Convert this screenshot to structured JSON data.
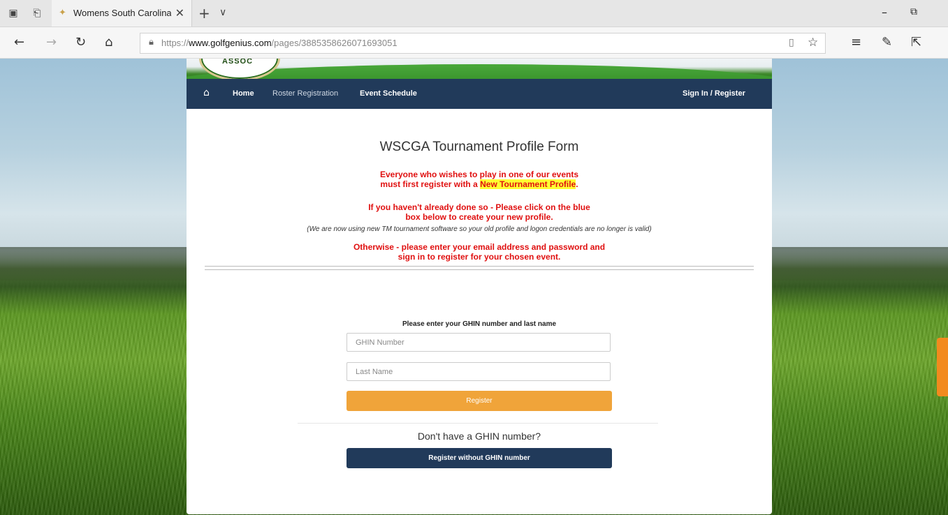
{
  "browser": {
    "tab_title": "Womens South Carolina",
    "url_prefix": "https://",
    "url_host": "www.golfgenius.com",
    "url_path": "/pages/3885358626071693051",
    "icons": [
      "tab-sets-icon",
      "tabs-aside-icon",
      "favicon-icon",
      "close-tab-icon",
      "new-tab-icon",
      "tab-list-icon",
      "minimize-icon",
      "restore-icon",
      "back-icon",
      "forward-icon",
      "refresh-icon",
      "home-icon",
      "lock-icon",
      "reading-view-icon",
      "favorite-star-icon",
      "favorites-icon",
      "pen-icon",
      "share-icon"
    ]
  },
  "site": {
    "logo_text": "ASSOC",
    "nav": {
      "home": "Home",
      "roster_registration": "Roster Registration",
      "event_schedule": "Event Schedule",
      "sign_in": "Sign In / Register"
    },
    "form_title": "WSCGA Tournament Profile Form",
    "message1_line1": "Everyone who wishes to play in one of our events",
    "message1_line2_prefix": "must first register with a ",
    "message1_highlight": "New Tournament Profile",
    "message1_line2_suffix": ".",
    "message2_line1": "If you haven't already done so - Please click on the blue",
    "message2_line2": "box below to create your new profile.",
    "note": "(We are now using new TM tournament software so your old profile and logon credentials are no longer is valid)",
    "message3_line1": "Otherwise - please enter your email address and password and",
    "message3_line2": "sign in to register for your chosen event.",
    "ghin_prompt": "Please enter your GHIN number and last name",
    "ghin_placeholder": "GHIN Number",
    "lastname_placeholder": "Last Name",
    "register_button": "Register",
    "no_ghin_text": "Don't have a GHIN number?",
    "register_without_button": "Register without GHIN number"
  },
  "colors": {
    "nav_bg": "#213a5a",
    "register_btn": "#f0a43a",
    "red_text": "#e01010",
    "highlight": "#ffff33"
  }
}
